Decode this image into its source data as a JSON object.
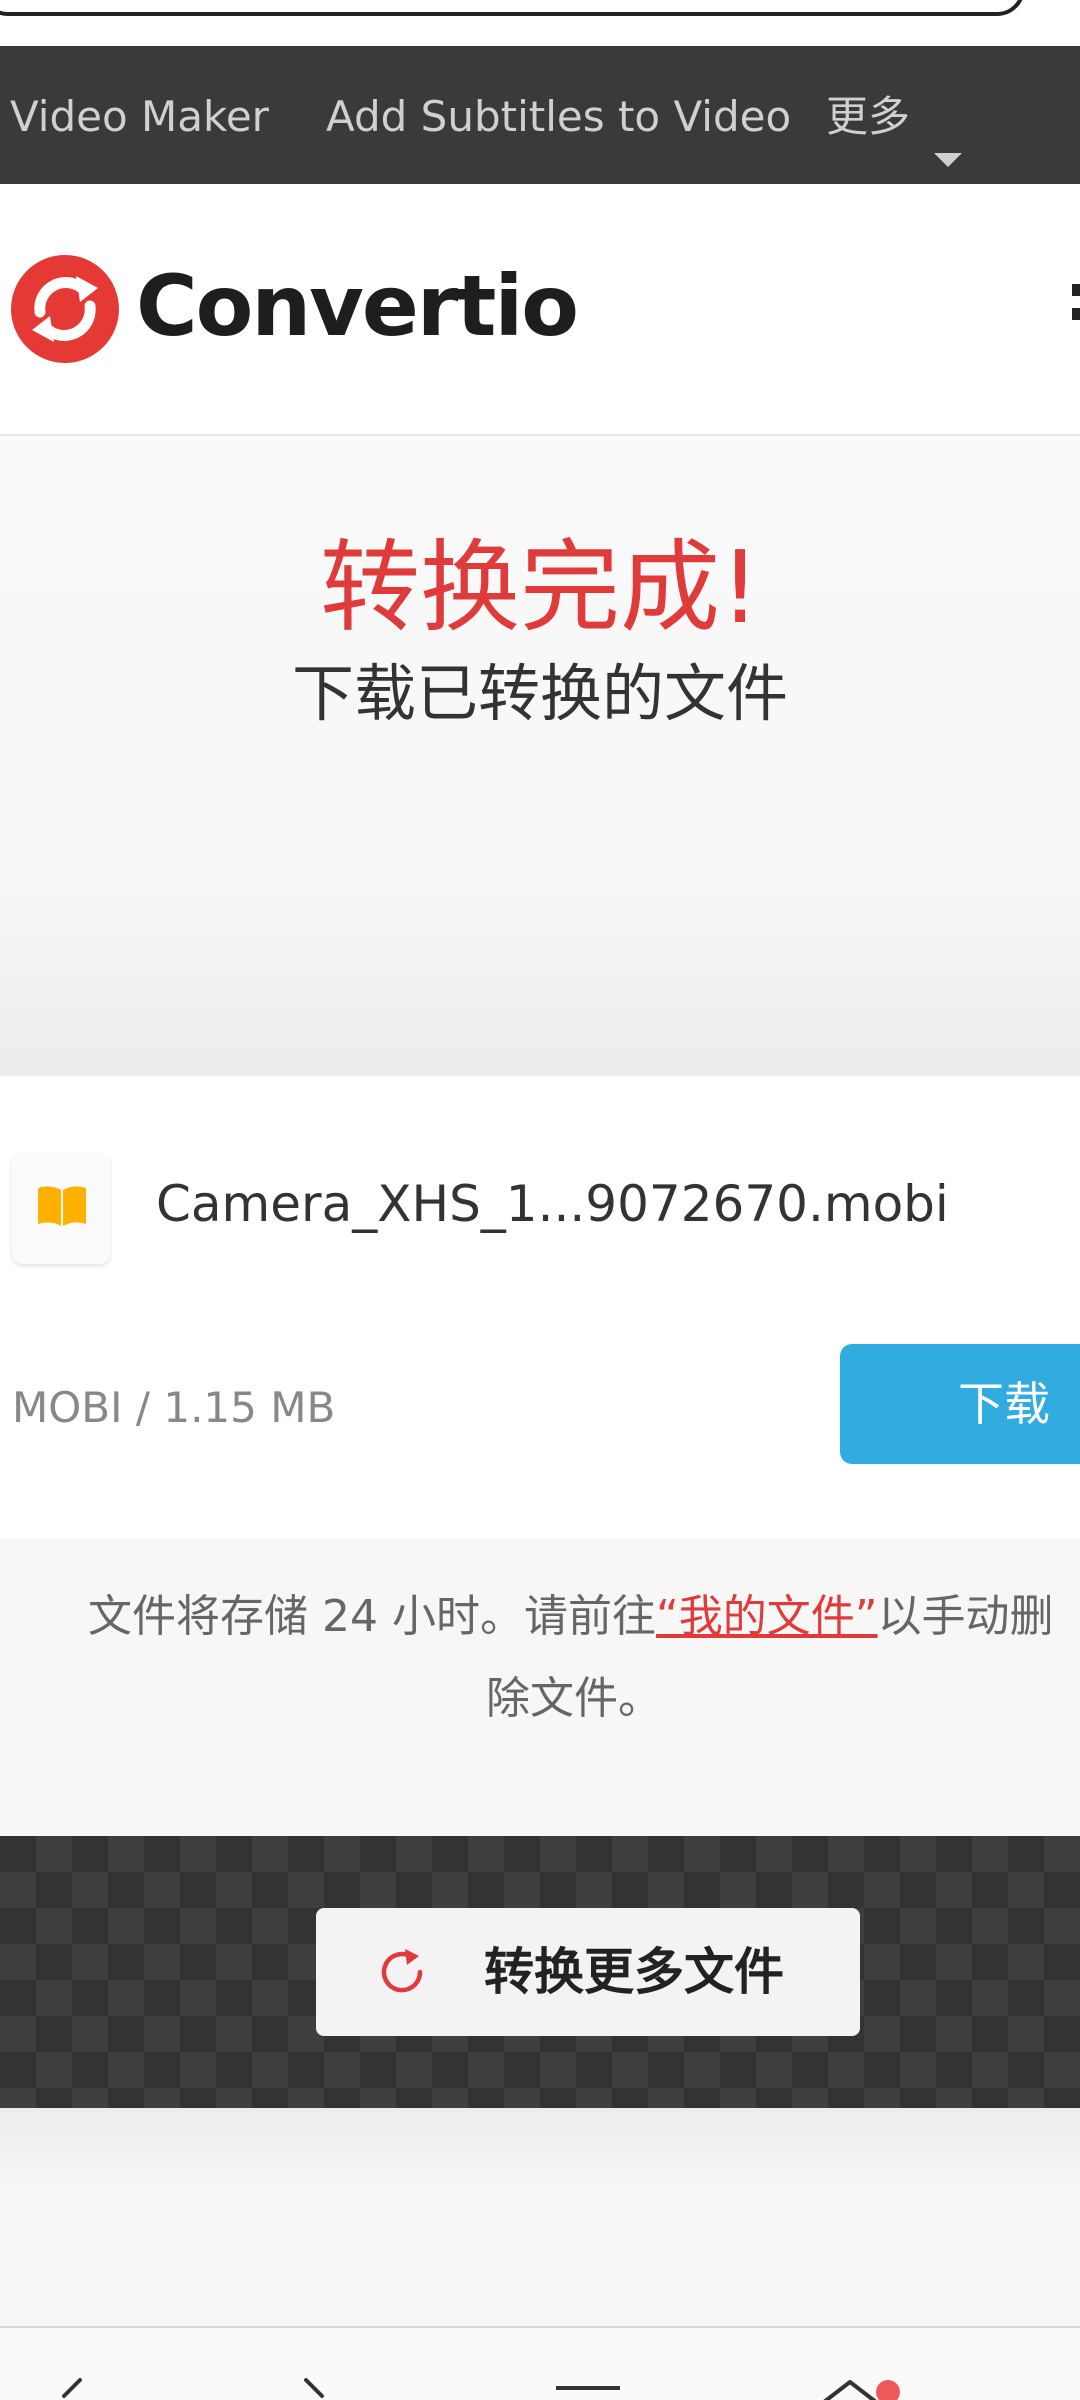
{
  "nav": {
    "items": [
      "Video Maker",
      "Add Subtitles to Video",
      "更多"
    ]
  },
  "brand": {
    "name": "Convertio",
    "color": "#e53935"
  },
  "hero": {
    "title": "转换完成!",
    "subtitle": "下载已转换的文件"
  },
  "file": {
    "name": "Camera_XHS_1...9072670.mobi",
    "meta": "MOBI / 1.15 MB",
    "download_label": "下载",
    "icon": "book-icon"
  },
  "info": {
    "text_before": "文件将存储 24 小时。请前往",
    "link": "“我的文件”",
    "text_after": "以手动删",
    "line2": "除文件。"
  },
  "actions": {
    "convert_more_label": "转换更多文件"
  },
  "colors": {
    "accent_red": "#e03b3b",
    "download_blue": "#31ace0",
    "nav_bg": "#3a3a3a"
  }
}
